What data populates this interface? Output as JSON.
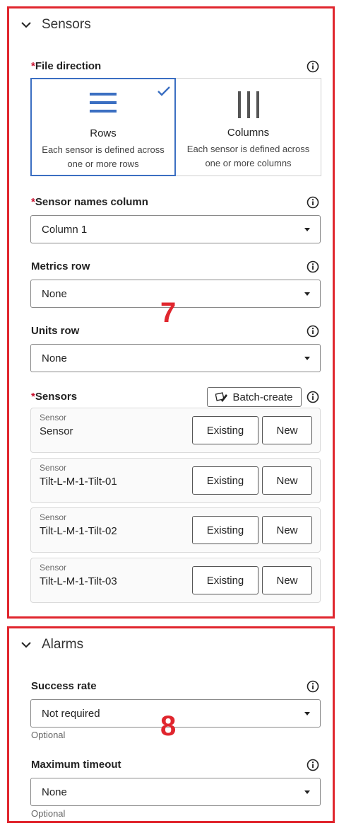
{
  "sensors_section": {
    "title": "Sensors",
    "number": "7",
    "file_direction": {
      "label": "File direction",
      "required_mark": "*",
      "options": [
        {
          "title": "Rows",
          "description": "Each sensor is defined across one or more rows",
          "selected": true
        },
        {
          "title": "Columns",
          "description": "Each sensor is defined across one or more columns",
          "selected": false
        }
      ]
    },
    "sensor_names_column": {
      "label": "Sensor names column",
      "required_mark": "*",
      "value": "Column 1"
    },
    "metrics_row": {
      "label": "Metrics row",
      "value": "None"
    },
    "units_row": {
      "label": "Units row",
      "value": "None"
    },
    "sensors": {
      "label": "Sensors",
      "required_mark": "*",
      "batch_create_label": "Batch-create",
      "existing_label": "Existing",
      "new_label": "New",
      "items": [
        {
          "caption": "Sensor",
          "name": "Sensor"
        },
        {
          "caption": "Sensor",
          "name": "Tilt-L-M-1-Tilt-01"
        },
        {
          "caption": "Sensor",
          "name": "Tilt-L-M-1-Tilt-02"
        },
        {
          "caption": "Sensor",
          "name": "Tilt-L-M-1-Tilt-03"
        }
      ]
    }
  },
  "alarms_section": {
    "title": "Alarms",
    "number": "8",
    "success_rate": {
      "label": "Success rate",
      "value": "Not required",
      "helper": "Optional"
    },
    "maximum_timeout": {
      "label": "Maximum timeout",
      "value": "None",
      "helper": "Optional"
    }
  },
  "colors": {
    "highlight_border": "#e0262e",
    "selected_accent": "#3b6fc2",
    "required": "#c8102e"
  }
}
